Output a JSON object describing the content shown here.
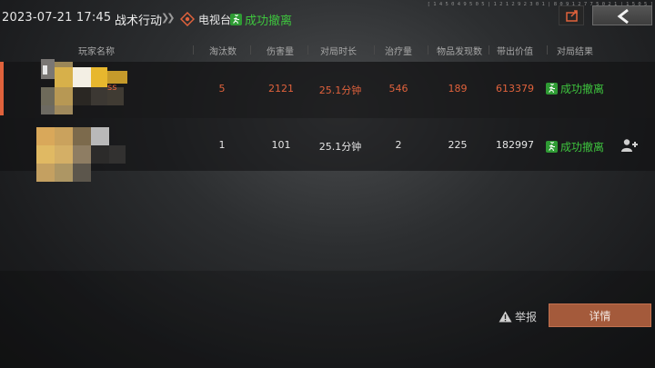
{
  "topbar": {
    "datetime": "2023-07-21 17:45",
    "mode": "战术行动",
    "map_name": "电视台",
    "status": "成功撤离",
    "uid_text": "[ 1 4 5 0 4 9 5 0 5 | 1 2 1 2 9 2 3 0 1 | 8 0 9 1 2 7 7 5 0 2 1 | 1 5 0 5 ]",
    "share_icon": "share-icon",
    "back_icon": "chevron-left-icon"
  },
  "table": {
    "headers": [
      "玩家名称",
      "淘汰数",
      "伤害量",
      "对局时长",
      "治疗量",
      "物品发现数",
      "带出价值",
      "对局结果"
    ],
    "rows": [
      {
        "name_suffix": "ss",
        "kills": "5",
        "damage": "2121",
        "duration": "25.1分钟",
        "healing": "546",
        "items_found": "189",
        "value": "613379",
        "result": "成功撤离"
      },
      {
        "name_suffix": "",
        "kills": "1",
        "damage": "101",
        "duration": "25.1分钟",
        "healing": "2",
        "items_found": "225",
        "value": "182997",
        "result": "成功撤离"
      }
    ]
  },
  "actions": {
    "report_label": "举报",
    "details_label": "详情"
  },
  "colors": {
    "self_row": "#e0623c",
    "success": "#3ec43e",
    "details_button": "#a45a3b"
  }
}
